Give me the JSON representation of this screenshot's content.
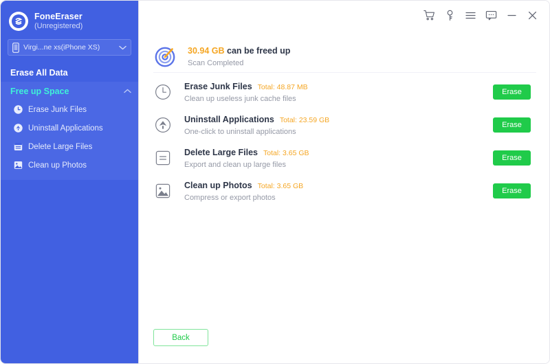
{
  "app": {
    "name": "FoneEraser",
    "registration_status": "(Unregistered)",
    "logo_icon": "fone-eraser-logo-icon"
  },
  "device_selector": {
    "value": "Virgi...ne xs(iPhone XS)",
    "icon": "phone-icon",
    "caret_icon": "chevron-down-icon"
  },
  "sidebar": {
    "top_item": {
      "label": "Erase All Data"
    },
    "section": {
      "label": "Free up Space",
      "chevron_icon": "chevron-up-icon",
      "expanded": true
    },
    "items": [
      {
        "label": "Erase Junk Files",
        "icon": "clock-icon"
      },
      {
        "label": "Uninstall Applications",
        "icon": "up-arrow-circle-icon"
      },
      {
        "label": "Delete Large Files",
        "icon": "list-document-icon"
      },
      {
        "label": "Clean up Photos",
        "icon": "photo-icon"
      }
    ]
  },
  "titlebar": {
    "icons": [
      {
        "name": "shopping-cart-icon"
      },
      {
        "name": "key-icon"
      },
      {
        "name": "hamburger-menu-icon"
      },
      {
        "name": "chat-bubble-icon"
      },
      {
        "name": "minimize-icon"
      },
      {
        "name": "close-icon"
      }
    ]
  },
  "main": {
    "scan": {
      "icon": "target-scan-icon",
      "amount": "30.94 GB",
      "title_suffix": " can be freed up",
      "status": "Scan Completed"
    },
    "rows": [
      {
        "icon": "clock-icon",
        "title": "Erase Junk Files",
        "total": "Total: 48.87 MB",
        "description": "Clean up useless junk cache files",
        "action_label": "Erase"
      },
      {
        "icon": "up-arrow-circle-icon",
        "title": "Uninstall Applications",
        "total": "Total: 23.59 GB",
        "description": "One-click to uninstall applications",
        "action_label": "Erase"
      },
      {
        "icon": "list-document-icon",
        "title": "Delete Large Files",
        "total": "Total: 3.65 GB",
        "description": "Export and clean up large files",
        "action_label": "Erase"
      },
      {
        "icon": "photo-icon",
        "title": "Clean up Photos",
        "total": "Total: 3.65 GB",
        "description": "Compress or export photos",
        "action_label": "Erase"
      }
    ],
    "back_label": "Back"
  },
  "colors": {
    "sidebar_bg": "#4160e1",
    "sidebar_section_bg": "#4b68e4",
    "accent_teal": "#3ff0d8",
    "accent_orange": "#f5a623",
    "accent_green": "#20cb4a",
    "text_dark": "#2e3648",
    "text_muted": "#9599a6"
  }
}
